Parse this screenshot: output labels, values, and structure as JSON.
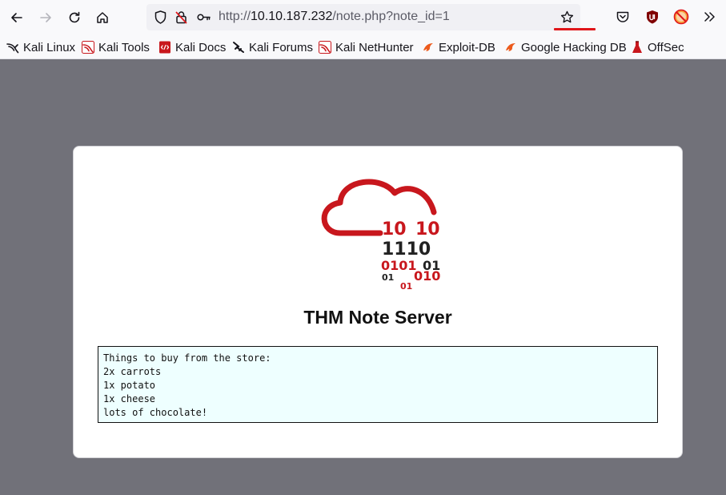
{
  "browser": {
    "url_prefix": "http://",
    "url_host": "10.10.187.232",
    "url_path": "/note.php?note_id=1"
  },
  "bookmarks": [
    {
      "label": "Kali Linux",
      "icon": "kali-dragon-icon"
    },
    {
      "label": "Kali Tools",
      "icon": "kali-tools-icon"
    },
    {
      "label": "Kali Docs",
      "icon": "kali-docs-icon"
    },
    {
      "label": "Kali Forums",
      "icon": "kali-forums-icon"
    },
    {
      "label": "Kali NetHunter",
      "icon": "kali-nethunter-icon"
    },
    {
      "label": "Exploit-DB",
      "icon": "exploit-db-icon"
    },
    {
      "label": "Google Hacking DB",
      "icon": "ghdb-icon"
    },
    {
      "label": "OffSec",
      "icon": "offsec-icon"
    }
  ],
  "page": {
    "logo": {
      "row1_left": "10",
      "row1_right": "10",
      "row2": "1110",
      "row3_left": "0101",
      "row3_right": "01",
      "row4_left": "01",
      "row4_right": "010",
      "row5": "01"
    },
    "title": "THM Note Server",
    "note_lines": [
      "Things to buy from the store:",
      "2x carrots",
      "1x potato",
      "1x cheese",
      "lots of chocolate!"
    ]
  },
  "colors": {
    "accent_red": "#c8171d",
    "page_background": "#717179",
    "note_background": "#eeffff"
  }
}
